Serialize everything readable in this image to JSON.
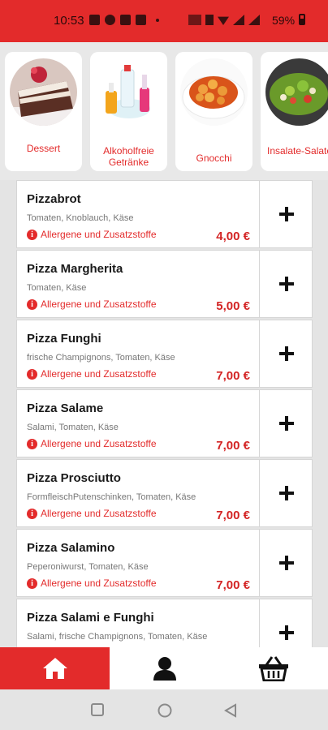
{
  "status_bar": {
    "time": "10:53",
    "battery": "59%"
  },
  "categories": [
    {
      "label": "Dessert"
    },
    {
      "label": "Alkoholfreie Getränke"
    },
    {
      "label": "Gnocchi"
    },
    {
      "label": "Insalate-Salate"
    }
  ],
  "allergen_label": "Allergene und Zusatzstoffe",
  "items": [
    {
      "name": "Pizzabrot",
      "desc": "Tomaten, Knoblauch, Käse",
      "price": "4,00 €"
    },
    {
      "name": "Pizza Margherita",
      "desc": "Tomaten, Käse",
      "price": "5,00 €"
    },
    {
      "name": "Pizza Funghi",
      "desc": "frische Champignons, Tomaten, Käse",
      "price": "7,00 €"
    },
    {
      "name": "Pizza Salame",
      "desc": "Salami, Tomaten, Käse",
      "price": "7,00 €"
    },
    {
      "name": "Pizza Prosciutto",
      "desc": "FormfleischPutenschinken, Tomaten, Käse",
      "price": "7,00 €"
    },
    {
      "name": "Pizza Salamino",
      "desc": "Peperoniwurst, Tomaten, Käse",
      "price": "7,00 €"
    },
    {
      "name": "Pizza Salami e Funghi",
      "desc": "Salami, frische Champignons, Tomaten, Käse",
      "price": ""
    }
  ],
  "bottom_nav": {
    "active": "home",
    "tabs": [
      "home-icon",
      "user-icon",
      "basket-icon"
    ]
  },
  "colors": {
    "accent": "#e32b2b",
    "price": "#d32424"
  }
}
